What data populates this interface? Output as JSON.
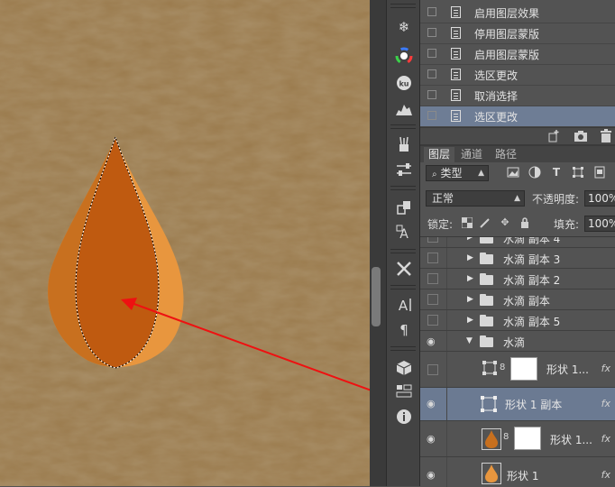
{
  "history_panel": {
    "items": [
      {
        "label": "启用图层效果",
        "selected": false
      },
      {
        "label": "停用图层蒙版",
        "selected": false
      },
      {
        "label": "启用图层蒙版",
        "selected": false
      },
      {
        "label": "选区更改",
        "selected": false
      },
      {
        "label": "取消选择",
        "selected": false
      },
      {
        "label": "选区更改",
        "selected": true
      }
    ]
  },
  "layers_panel": {
    "tabs": [
      {
        "label": "图层",
        "active": true
      },
      {
        "label": "通道",
        "active": false
      },
      {
        "label": "路径",
        "active": false
      }
    ],
    "filter_label": "类型",
    "blend_mode": "正常",
    "opacity_label": "不透明度:",
    "opacity_value": "100%",
    "lock_label": "锁定:",
    "fill_label": "填充:",
    "fill_value": "100%",
    "layers": [
      {
        "name": "水滴 副本 4",
        "type": "group",
        "visible": false,
        "expanded": false
      },
      {
        "name": "水滴 副本 3",
        "type": "group",
        "visible": false,
        "expanded": false
      },
      {
        "name": "水滴 副本 2",
        "type": "group",
        "visible": false,
        "expanded": false
      },
      {
        "name": "水滴 副本",
        "type": "group",
        "visible": false,
        "expanded": false
      },
      {
        "name": "水滴 副本 5",
        "type": "group",
        "visible": false,
        "expanded": false
      },
      {
        "name": "水滴",
        "type": "group",
        "visible": true,
        "expanded": true
      },
      {
        "name": "形状 1...",
        "type": "shape-with-mask",
        "visible": false,
        "fx": "fx"
      },
      {
        "name": "形状 1 副本",
        "type": "shape",
        "visible": true,
        "selected": true,
        "fx": "fx"
      },
      {
        "name": "形状 1...",
        "type": "shape-with-mask",
        "visible": true,
        "fx": "fx"
      },
      {
        "name": "形状 1",
        "type": "shape",
        "visible": true,
        "fx": "fx"
      }
    ]
  },
  "toolbar": {
    "icons": [
      "history-brush-icon",
      "snowflake-icon",
      "color-wheel-icon",
      "ku-icon",
      "histogram-icon",
      "brush-presets-icon",
      "adjustments-icon",
      "clone-source-icon",
      "character-styles-icon",
      "tools-icon",
      "character-icon",
      "paragraph-icon",
      "3d-icon",
      "layer-comps-icon",
      "info-icon"
    ],
    "ku_label": "ku"
  },
  "colors": {
    "canvas_bg": "#9a7a4c",
    "drop_light": "#e8963e",
    "drop_mid": "#c8701f",
    "drop_dark": "#bf5a10",
    "arrow": "#ee1111",
    "selected_row": "#6b7a92",
    "panel_bg": "#535353"
  }
}
